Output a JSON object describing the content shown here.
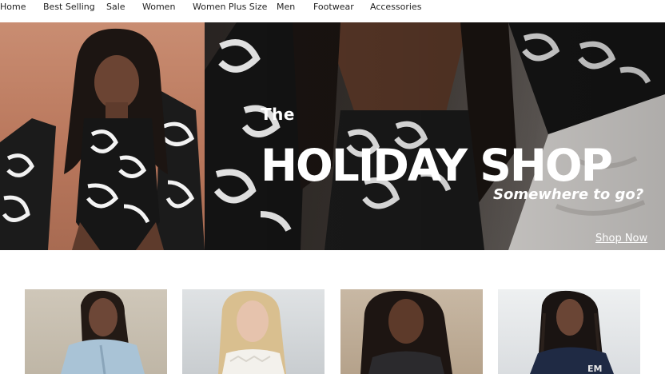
{
  "nav": {
    "items": [
      {
        "label": "Home"
      },
      {
        "label": "Best Selling"
      },
      {
        "label": "Sale"
      },
      {
        "label": "Women"
      },
      {
        "label": "Women Plus Size"
      },
      {
        "label": "Men"
      },
      {
        "label": "Footwear"
      },
      {
        "label": "Accessories"
      }
    ]
  },
  "hero": {
    "eyebrow": "The",
    "title": "HOLIDAY SHOP",
    "subtitle": "Somewhere to go?",
    "cta": "Shop Now"
  },
  "tiles": [
    {
      "name": "model-photo-blue-jacket"
    },
    {
      "name": "model-photo-white-knit"
    },
    {
      "name": "model-photo-dark-hoodie"
    },
    {
      "name": "model-photo-navy-sweatshirt"
    }
  ],
  "colors": {
    "hero_left_bg": "#b9775c",
    "hero_right_bg": "#3a3430",
    "nav_text": "#222222"
  }
}
